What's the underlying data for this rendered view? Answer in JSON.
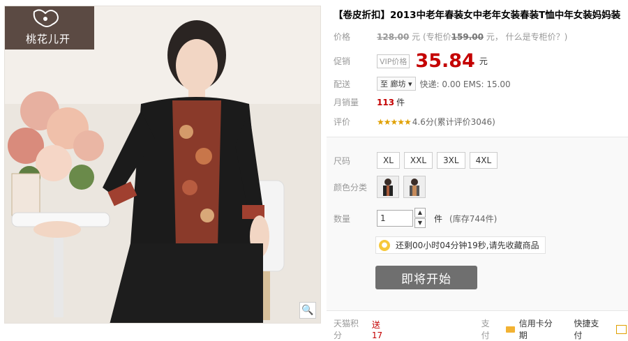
{
  "brand": {
    "logo_text": "桃花儿开"
  },
  "product": {
    "title": "【卷皮折扣】2013中老年春装女中老年女装春装T恤中年女装妈妈装"
  },
  "price": {
    "label": "价格",
    "original": "128.00",
    "unit": "元",
    "counter_prefix": "(专柜价",
    "counter_value": "159.00",
    "counter_unit": "元，",
    "counter_link": "什么是专柜价？)"
  },
  "promo": {
    "label": "促销",
    "vip_tag": "VIP价格",
    "price": "35.84",
    "unit": "元"
  },
  "shipping": {
    "label": "配送",
    "to": "至 廊坊",
    "info": "快递: 0.00 EMS: 15.00"
  },
  "sales": {
    "label": "月销量",
    "count": "113",
    "unit": "件"
  },
  "rating": {
    "label": "评价",
    "stars": "★★★★★",
    "score": "4.6分",
    "count": "(累计评价3046)"
  },
  "options": {
    "size_label": "尺码",
    "sizes": [
      "XL",
      "XXL",
      "3XL",
      "4XL"
    ],
    "color_label": "颜色分类",
    "qty_label": "数量",
    "qty_value": "1",
    "qty_unit": "件",
    "stock": "(库存744件)"
  },
  "countdown": {
    "text": "还剩00小时04分钟19秒,请先收藏商品"
  },
  "buy_button": {
    "label": "即将开始"
  },
  "footer": {
    "points_label": "天猫积分",
    "points_value": "送17",
    "pay_label": "支付",
    "card_pay": "信用卡分期",
    "quick_pay": "快捷支付"
  },
  "colors": {
    "price_red": "#c40000",
    "button_gray": "#6f6f6f",
    "logo_bg": "#5b4a43"
  }
}
